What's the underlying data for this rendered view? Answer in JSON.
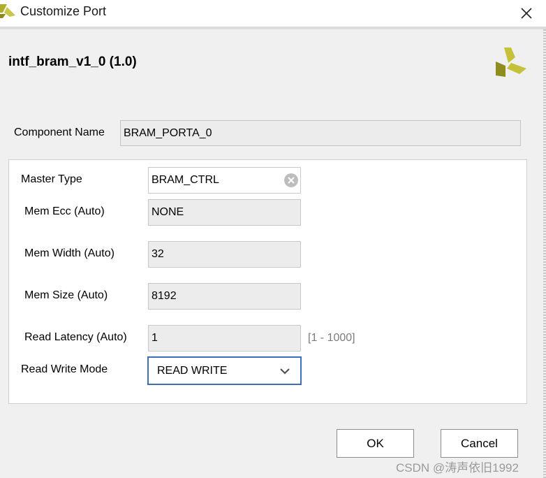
{
  "window": {
    "title": "Customize Port",
    "close_icon": "close-icon",
    "app_icon": "xilinx-logo-icon"
  },
  "header": {
    "ip_title": "intf_bram_v1_0 (1.0)",
    "logo_icon": "xilinx-logo-icon",
    "logo_color": "#a8a821"
  },
  "component": {
    "label": "Component Name",
    "value": "BRAM_PORTA_0"
  },
  "params": {
    "master_type": {
      "label": "Master Type",
      "value": "BRAM_CTRL"
    },
    "mem_ecc": {
      "label": "Mem Ecc (Auto)",
      "value": "NONE"
    },
    "mem_width": {
      "label": "Mem Width (Auto)",
      "value": "32"
    },
    "mem_size": {
      "label": "Mem Size (Auto)",
      "value": "8192"
    },
    "read_latency": {
      "label": "Read Latency (Auto)",
      "value": "1",
      "range": "[1 - 1000]"
    },
    "read_write_mode": {
      "label": "Read Write Mode",
      "value": "READ WRITE"
    }
  },
  "buttons": {
    "ok": "OK",
    "cancel": "Cancel"
  },
  "watermark": "CSDN @涛声依旧1992",
  "colors": {
    "focus_border": "#3e6fb3",
    "readonly_bg": "#ececec"
  }
}
